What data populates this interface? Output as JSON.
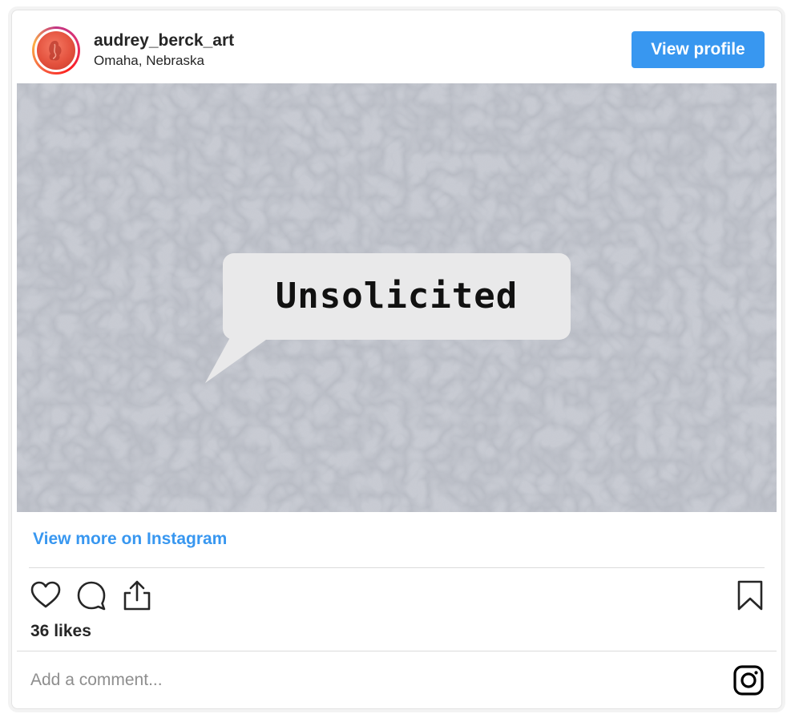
{
  "header": {
    "username": "audrey_berck_art",
    "location": "Omaha, Nebraska",
    "view_profile_label": "View profile",
    "avatar_icon": "profile-photo"
  },
  "post": {
    "image_caption_text": "Unsolicited",
    "image_background": "gray-paper-texture"
  },
  "footer": {
    "view_more_label": "View more on Instagram",
    "likes_text": "36 likes",
    "comment_placeholder": "Add a comment...",
    "icons": [
      "heart-icon",
      "comment-icon",
      "share-icon",
      "bookmark-icon",
      "instagram-logo-icon"
    ]
  },
  "colors": {
    "accent": "#3897f0",
    "text": "#262626",
    "muted": "#8e8e8e",
    "divider": "#dbdbdb"
  }
}
